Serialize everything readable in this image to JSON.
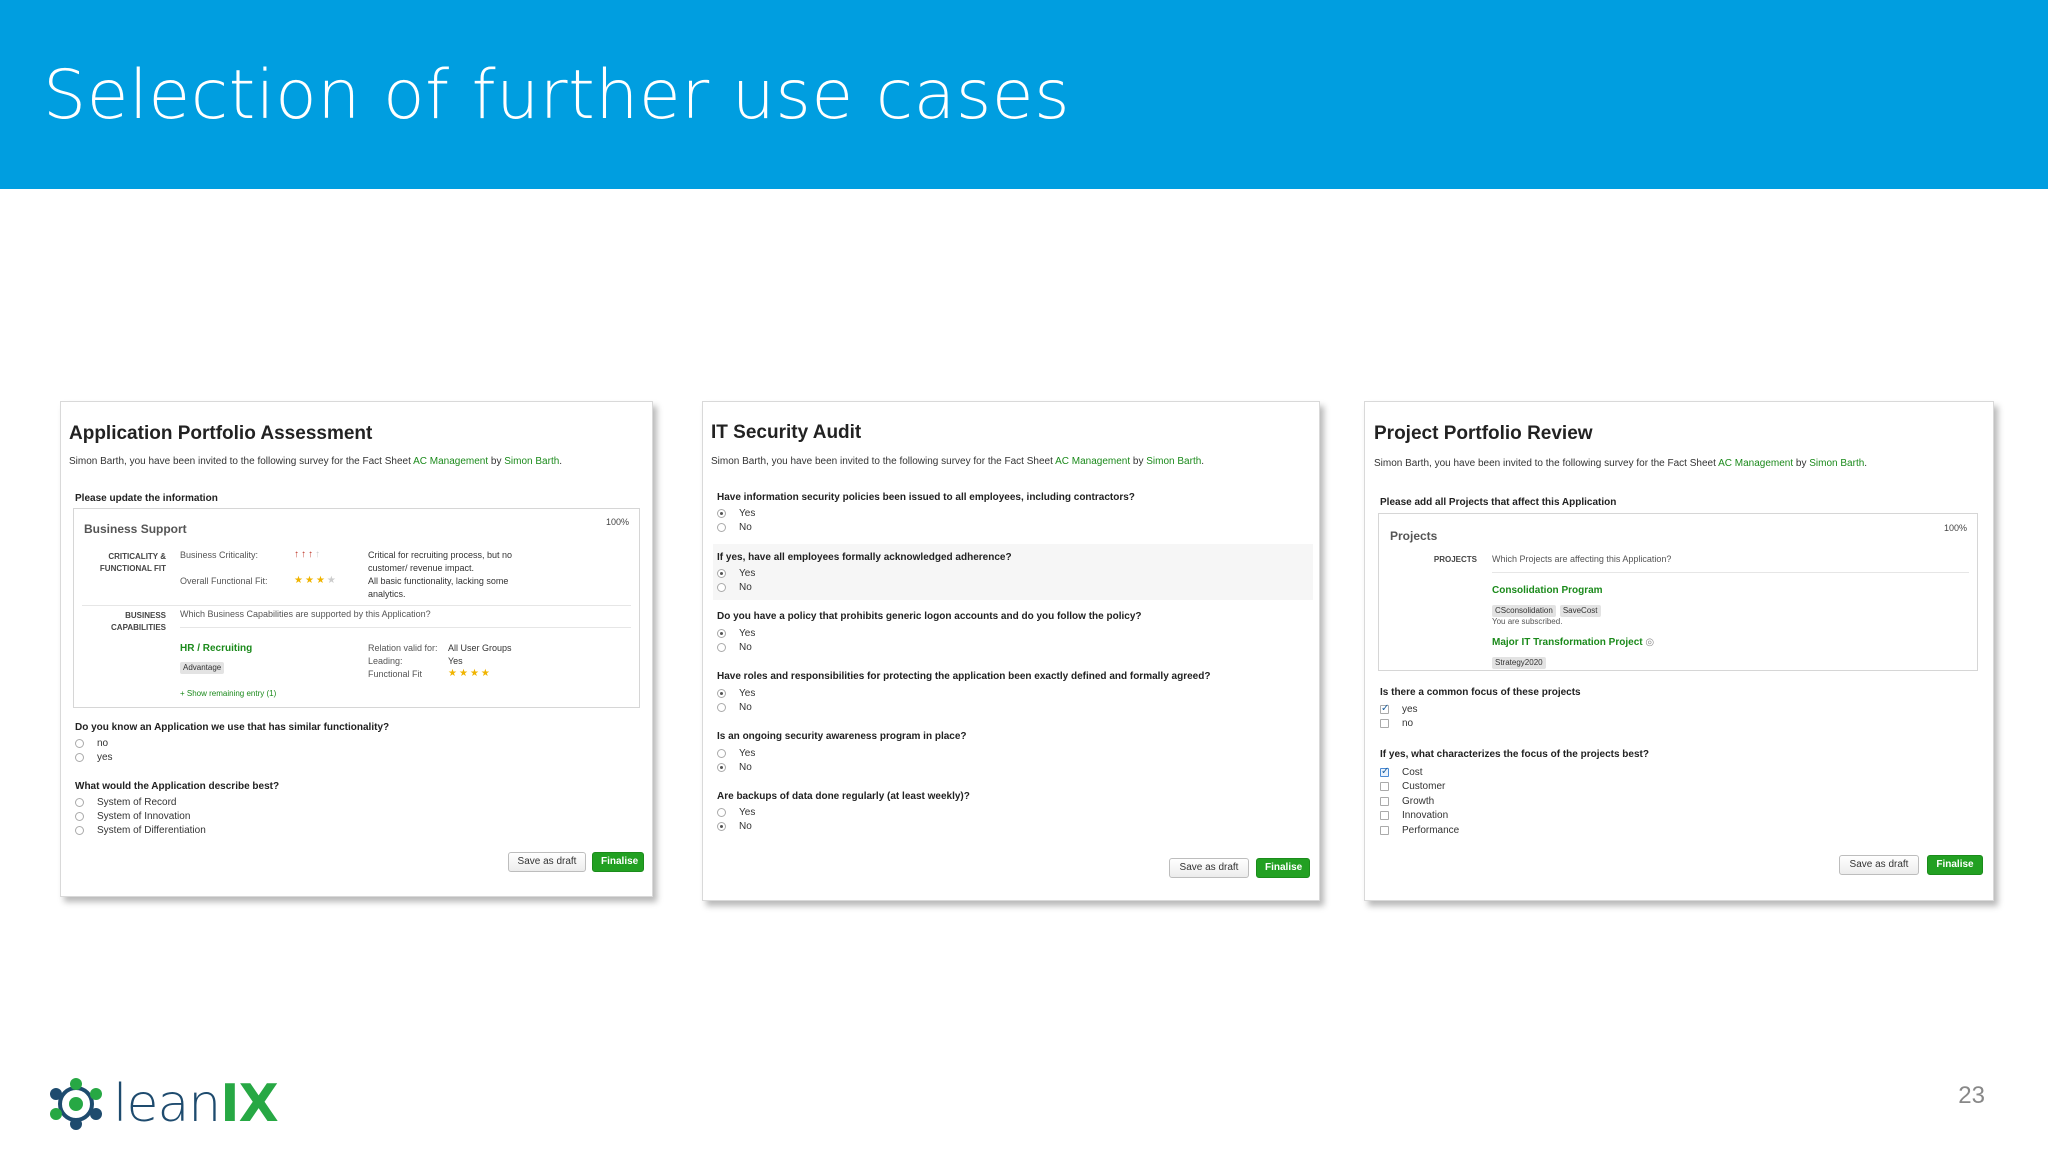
{
  "header": {
    "title": "Selection of further use cases"
  },
  "cards": [
    {
      "title": "Application Portfolio Assessment",
      "invite_prefix": "Simon Barth, you have been invited to the following survey for the Fact Sheet ",
      "invite_link1": "AC Management",
      "invite_by": " by ",
      "invite_link2": "Simon Barth",
      "invite_end": ".",
      "update_heading": "Please update the information",
      "box_title": "Business Support",
      "box_pct": "100%",
      "criticality_label_1": "CRITICALITY &",
      "criticality_label_2": "FUNCTIONAL FIT",
      "business_criticality_label": "Business Criticality:",
      "business_criticality_level": "3 of 4",
      "business_criticality_text_1": "Critical for recruiting process, but no",
      "business_criticality_text_2": "customer/ revenue impact.",
      "functional_fit_label": "Overall Functional Fit:",
      "functional_fit_level": "3 of 4",
      "functional_fit_text_1": "All basic functionality, lacking some",
      "functional_fit_text_2": "analytics.",
      "capabilities_label_1": "BUSINESS",
      "capabilities_label_2": "CAPABILITIES",
      "capabilities_question": "Which Business Capabilities are supported by this Application?",
      "capability_name": "HR / Recruiting",
      "capability_tag": "Advantage",
      "relation_valid_label": "Relation valid for:",
      "relation_valid_value": "All User Groups",
      "leading_label": "Leading:",
      "leading_value": "Yes",
      "functional_fit_short_label": "Functional Fit",
      "functional_fit_short_level": "4 of 4",
      "show_remaining": "+ Show remaining entry (1)",
      "q1": "Do you know an Application we use that has similar functionality?",
      "q1_options": [
        "no",
        "yes"
      ],
      "q2": "What would the Application describe best?",
      "q2_options": [
        "System of Record",
        "System of Innovation",
        "System of Differentiation"
      ],
      "save_draft": "Save as draft",
      "finalise": "Finalise"
    },
    {
      "title": "IT Security Audit",
      "invite_prefix": "Simon Barth, you have been invited to the following survey for the Fact Sheet ",
      "invite_link1": "AC Management",
      "invite_by": " by ",
      "invite_link2": "Simon Barth",
      "invite_end": ".",
      "questions": [
        {
          "q": "Have information security policies been issued to all employees, including contractors?",
          "options": [
            "Yes",
            "No"
          ],
          "selected": "Yes"
        },
        {
          "q": "If yes, have all employees formally acknowledged adherence?",
          "options": [
            "Yes",
            "No"
          ],
          "selected": "Yes"
        },
        {
          "q": "Do you have a policy that prohibits generic logon accounts and do you follow the policy?",
          "options": [
            "Yes",
            "No"
          ],
          "selected": "Yes"
        },
        {
          "q": "Have roles and responsibilities for protecting the application been exactly defined and formally agreed?",
          "options": [
            "Yes",
            "No"
          ],
          "selected": "Yes"
        },
        {
          "q": "Is an ongoing security awareness program in place?",
          "options": [
            "Yes",
            "No"
          ],
          "selected": "No"
        },
        {
          "q": "Are backups of data done regularly (at least weekly)?",
          "options": [
            "Yes",
            "No"
          ],
          "selected": "No"
        }
      ],
      "save_draft": "Save as draft",
      "finalise": "Finalise"
    },
    {
      "title": "Project Portfolio Review",
      "invite_prefix": "Simon Barth, you have been invited to the following survey for the Fact Sheet ",
      "invite_link1": "AC Management",
      "invite_by": " by ",
      "invite_link2": "Simon Barth",
      "invite_end": ".",
      "add_heading": "Please add all Projects that affect this Application",
      "box_title": "Projects",
      "box_pct": "100%",
      "projects_label": "PROJECTS",
      "projects_question": "Which Projects are affecting this Application?",
      "project1_name": "Consolidation Program",
      "project1_tags": [
        "CSconsolidation",
        "SaveCost"
      ],
      "subscribed_text": "You are subscribed.",
      "project2_name": "Major IT Transformation Project",
      "project2_tags": [
        "Strategy2020"
      ],
      "q1": "Is there a common focus of these projects",
      "q1_options": [
        "yes",
        "no"
      ],
      "q1_selected": "yes",
      "q2": "If yes, what characterizes the focus of the projects best?",
      "q2_options": [
        "Cost",
        "Customer",
        "Growth",
        "Innovation",
        "Performance"
      ],
      "q2_selected": "Cost",
      "save_draft": "Save as draft",
      "finalise": "Finalise"
    }
  ],
  "footer": {
    "logo_text_main": "lean",
    "logo_text_accent": "IX",
    "page_number": "23"
  },
  "colors": {
    "header_blue": "#009ee0",
    "link_green": "#1b8a1b",
    "finalise_green": "#22a022",
    "logo_navy": "#1e4b6e",
    "logo_green": "#27a844"
  }
}
